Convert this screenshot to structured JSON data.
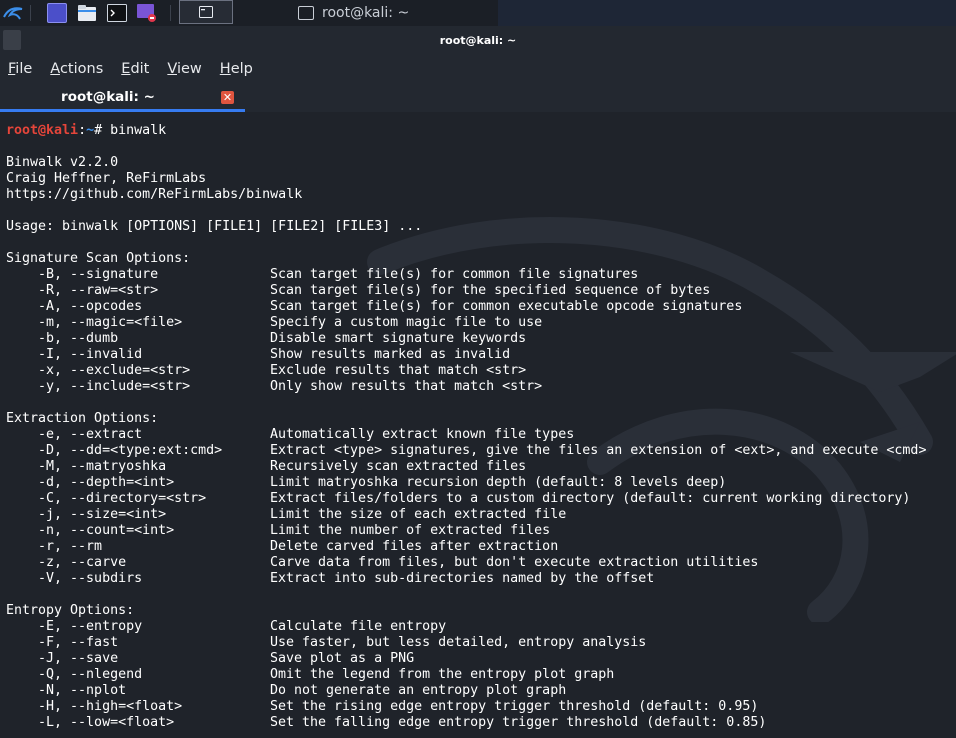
{
  "taskbar": {
    "window_label": "root@kali: ~"
  },
  "window": {
    "title": "root@kali: ~"
  },
  "menu": [
    {
      "label": "File",
      "mnemonic": "F",
      "rest": "ile"
    },
    {
      "label": "Actions",
      "mnemonic": "A",
      "rest": "ctions"
    },
    {
      "label": "Edit",
      "mnemonic": "E",
      "rest": "dit"
    },
    {
      "label": "View",
      "mnemonic": "V",
      "rest": "iew"
    },
    {
      "label": "Help",
      "mnemonic": "H",
      "rest": "elp"
    }
  ],
  "tab": {
    "label": "root@kali: ~",
    "close_glyph": "✕"
  },
  "prompt": {
    "user": "root@kali",
    "colon": ":",
    "path": "~",
    "hash": "# ",
    "command": "binwalk"
  },
  "header": {
    "version": "Binwalk v2.2.0",
    "author": "Craig Heffner, ReFirmLabs",
    "url": "https://github.com/ReFirmLabs/binwalk",
    "usage": "Usage: binwalk [OPTIONS] [FILE1] [FILE2] [FILE3] ..."
  },
  "sections": [
    {
      "title": "Signature Scan Options:",
      "options": [
        {
          "flag": "    -B, --signature",
          "desc": "Scan target file(s) for common file signatures"
        },
        {
          "flag": "    -R, --raw=<str>",
          "desc": "Scan target file(s) for the specified sequence of bytes"
        },
        {
          "flag": "    -A, --opcodes",
          "desc": "Scan target file(s) for common executable opcode signatures"
        },
        {
          "flag": "    -m, --magic=<file>",
          "desc": "Specify a custom magic file to use"
        },
        {
          "flag": "    -b, --dumb",
          "desc": "Disable smart signature keywords"
        },
        {
          "flag": "    -I, --invalid",
          "desc": "Show results marked as invalid"
        },
        {
          "flag": "    -x, --exclude=<str>",
          "desc": "Exclude results that match <str>"
        },
        {
          "flag": "    -y, --include=<str>",
          "desc": "Only show results that match <str>"
        }
      ]
    },
    {
      "title": "Extraction Options:",
      "options": [
        {
          "flag": "    -e, --extract",
          "desc": "Automatically extract known file types"
        },
        {
          "flag": "    -D, --dd=<type:ext:cmd>",
          "desc": "Extract <type> signatures, give the files an extension of <ext>, and execute <cmd>"
        },
        {
          "flag": "    -M, --matryoshka",
          "desc": "Recursively scan extracted files"
        },
        {
          "flag": "    -d, --depth=<int>",
          "desc": "Limit matryoshka recursion depth (default: 8 levels deep)"
        },
        {
          "flag": "    -C, --directory=<str>",
          "desc": "Extract files/folders to a custom directory (default: current working directory)"
        },
        {
          "flag": "    -j, --size=<int>",
          "desc": "Limit the size of each extracted file"
        },
        {
          "flag": "    -n, --count=<int>",
          "desc": "Limit the number of extracted files"
        },
        {
          "flag": "    -r, --rm",
          "desc": "Delete carved files after extraction"
        },
        {
          "flag": "    -z, --carve",
          "desc": "Carve data from files, but don't execute extraction utilities"
        },
        {
          "flag": "    -V, --subdirs",
          "desc": "Extract into sub-directories named by the offset"
        }
      ]
    },
    {
      "title": "Entropy Options:",
      "options": [
        {
          "flag": "    -E, --entropy",
          "desc": "Calculate file entropy"
        },
        {
          "flag": "    -F, --fast",
          "desc": "Use faster, but less detailed, entropy analysis"
        },
        {
          "flag": "    -J, --save",
          "desc": "Save plot as a PNG"
        },
        {
          "flag": "    -Q, --nlegend",
          "desc": "Omit the legend from the entropy plot graph"
        },
        {
          "flag": "    -N, --nplot",
          "desc": "Do not generate an entropy plot graph"
        },
        {
          "flag": "    -H, --high=<float>",
          "desc": "Set the rising edge entropy trigger threshold (default: 0.95)"
        },
        {
          "flag": "    -L, --low=<float>",
          "desc": "Set the falling edge entropy trigger threshold (default: 0.85)"
        }
      ]
    }
  ],
  "colors": {
    "accent": "#367bf0",
    "prompt_user": "#e5453a",
    "prompt_path": "#3b8eea",
    "background": "#1f232a"
  }
}
